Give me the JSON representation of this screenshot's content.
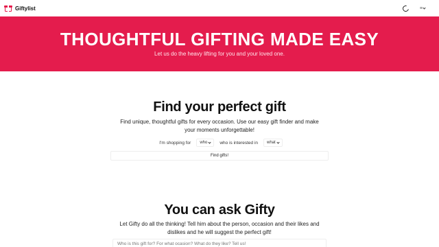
{
  "header": {
    "brand": "Giftylist",
    "lang_label": "≡",
    "icons": [
      "gift-icon",
      "theme-toggle-icon",
      "language-icon"
    ]
  },
  "hero": {
    "title": "THOUGHTFUL GIFTING MADE EASY",
    "subtitle": "Let us do the heavy lifting for you and your loved one.",
    "background_color": "#e41c4d"
  },
  "finder": {
    "title": "Find your perfect gift",
    "description": "Find unique, thoughtful gifts for every occasion. Use our easy gift finder and make your moments unforgettable!",
    "label_shopping_for": "I'm shopping for",
    "who_select": "who",
    "label_interested_in": "who is interested in",
    "what_select": "what",
    "button": "Find gifts!"
  },
  "ask": {
    "title": "You can ask Gifty",
    "description": "Let Gifty do all the thinking! Tell him about the person, occasion and their likes and dislikes and he will suggest the perfect gift!",
    "placeholder": "Who is this gift for? For what ocasion? What do they like? Tell us!"
  }
}
